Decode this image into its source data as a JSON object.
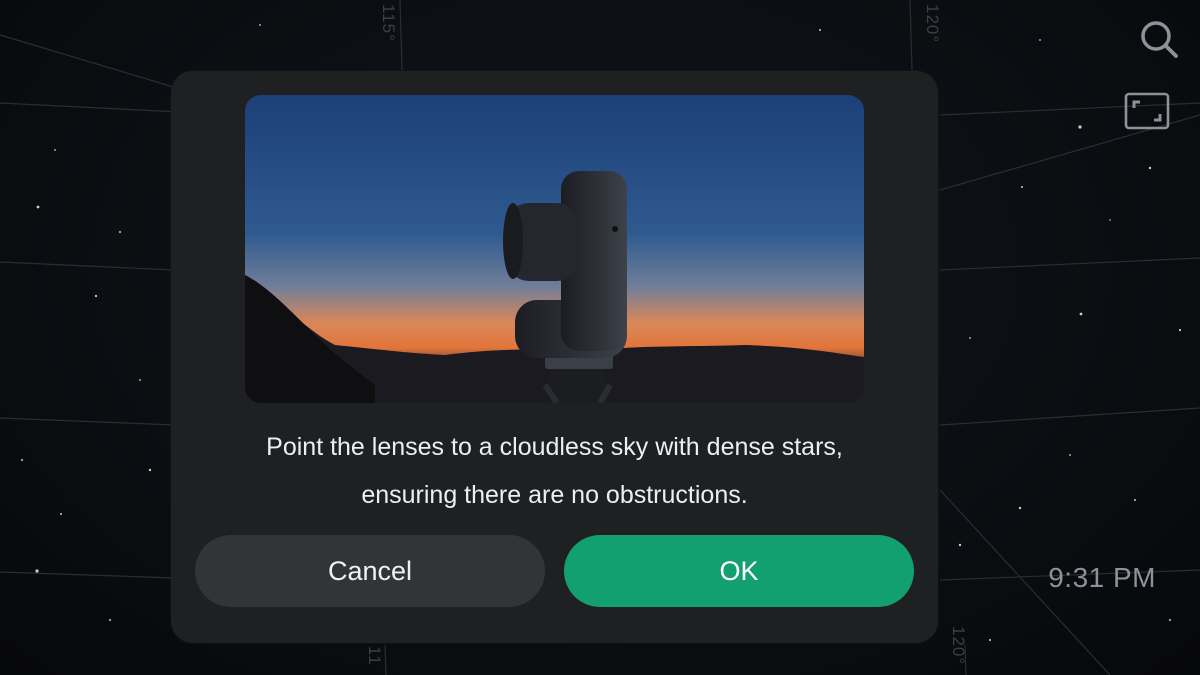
{
  "sky_map": {
    "grid_labels": [
      "115°",
      "120°",
      "11",
      "120°"
    ]
  },
  "controls": {
    "search_icon": "search-icon",
    "fullscreen_icon": "fullscreen-icon"
  },
  "status": {
    "time": "9:31 PM"
  },
  "dialog": {
    "message_line1": "Point the lenses to a cloudless sky with dense stars,",
    "message_line2": "ensuring there are no obstructions.",
    "cancel_label": "Cancel",
    "ok_label": "OK",
    "colors": {
      "ok": "#13a070",
      "cancel": "#333436",
      "background": "#1f2022"
    }
  }
}
